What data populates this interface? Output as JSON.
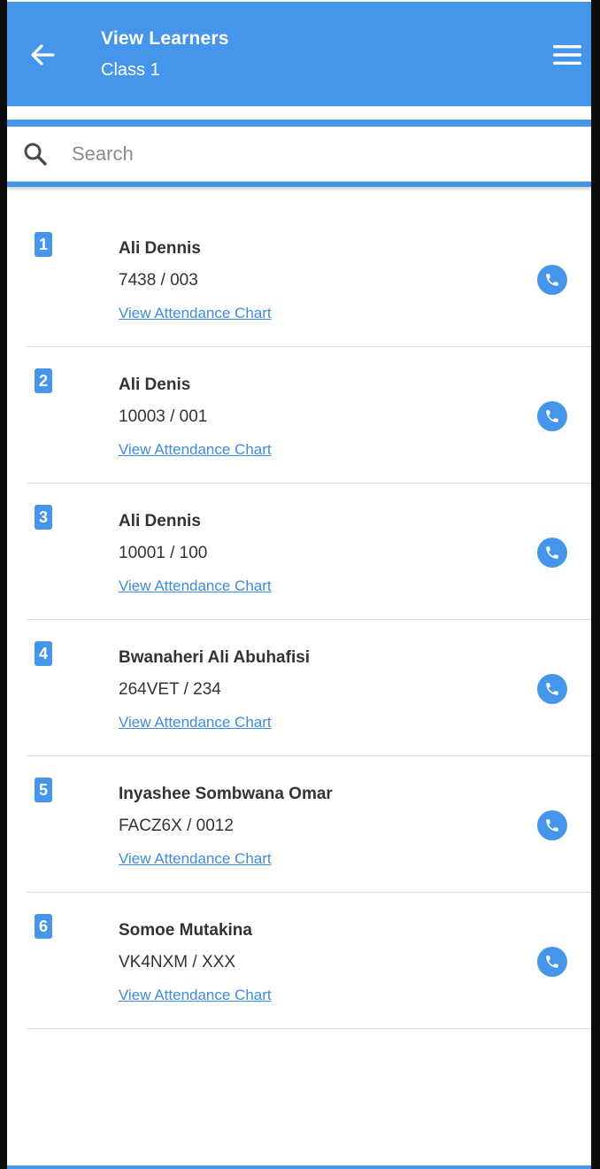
{
  "header": {
    "title": "View Learners",
    "subtitle": "Class 1",
    "back_icon": "arrow-left-icon",
    "menu_icon": "hamburger-menu-icon"
  },
  "search": {
    "placeholder": "Search",
    "value": "",
    "icon": "search-icon"
  },
  "colors": {
    "accent": "#4596ea",
    "link": "#3c8be0",
    "text": "#333333",
    "divider": "#dedede"
  },
  "learners": [
    {
      "index": "1",
      "name": "Ali Dennis",
      "code": "7438 / 003",
      "link": "View Attendance Chart",
      "action_icon": "phone-icon"
    },
    {
      "index": "2",
      "name": "Ali Denis",
      "code": "10003 / 001",
      "link": "View Attendance Chart",
      "action_icon": "phone-icon"
    },
    {
      "index": "3",
      "name": "Ali Dennis",
      "code": "10001 / 100",
      "link": "View Attendance Chart",
      "action_icon": "phone-icon"
    },
    {
      "index": "4",
      "name": "Bwanaheri Ali Abuhafisi",
      "code": "264VET / 234",
      "link": "View Attendance Chart",
      "action_icon": "phone-icon"
    },
    {
      "index": "5",
      "name": "Inyashee Sombwana Omar",
      "code": "FACZ6X / 0012",
      "link": "View Attendance Chart",
      "action_icon": "phone-icon"
    },
    {
      "index": "6",
      "name": "Somoe Mutakina",
      "code": "VK4NXM / XXX",
      "link": "View Attendance Chart",
      "action_icon": "phone-icon"
    }
  ]
}
